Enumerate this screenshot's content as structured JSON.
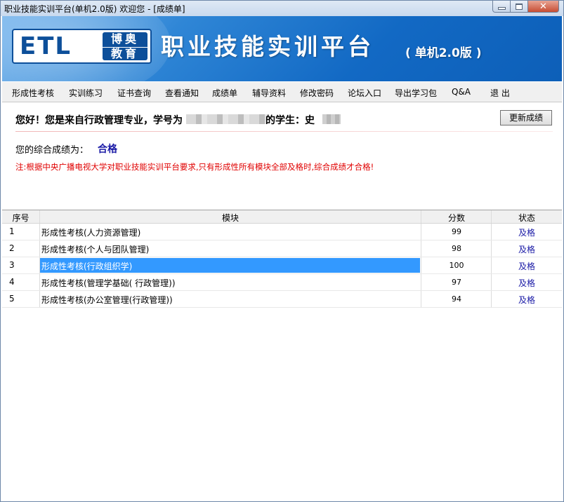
{
  "window": {
    "title": "职业技能实训平台(单机2.0版)  欢迎您 - [成绩单]",
    "controls": [
      "minimize-icon",
      "maximize-icon",
      "close-icon"
    ]
  },
  "banner": {
    "logo_text": "ETL",
    "logo_sub_line1": "博奥",
    "logo_sub_line2": "教育",
    "headline": "职业技能实训平台",
    "edition": "( 单机2.0版 )"
  },
  "menu": {
    "items": [
      "形成性考核",
      "实训练习",
      "证书查询",
      "查看通知",
      "成绩单",
      "辅导资料",
      "修改密码",
      "论坛入口",
      "导出学习包",
      "Q&A",
      "退 出"
    ]
  },
  "greeting": {
    "prefix": "您好！您是来自行政管理专业，学号为",
    "suffix": "的学生：史"
  },
  "update_button": "更新成绩",
  "score": {
    "label": "您的综合成绩为：",
    "value": "合格"
  },
  "notice": "注:根据中央广播电视大学对职业技能实训平台要求,只有形成性所有模块全部及格时,综合成绩才合格!",
  "table": {
    "headers": [
      "序号",
      "模块",
      "分数",
      "状态"
    ],
    "rows": [
      {
        "idx": "1",
        "module": "形成性考核(人力资源管理)",
        "score": "99",
        "status": "及格"
      },
      {
        "idx": "2",
        "module": "形成性考核(个人与团队管理)",
        "score": "98",
        "status": "及格"
      },
      {
        "idx": "3",
        "module": "形成性考核(行政组织学)",
        "score": "100",
        "status": "及格"
      },
      {
        "idx": "4",
        "module": "形成性考核(管理学基础( 行政管理))",
        "score": "97",
        "status": "及格"
      },
      {
        "idx": "5",
        "module": "形成性考核(办公室管理(行政管理))",
        "score": "94",
        "status": "及格"
      }
    ],
    "selected_row": 3
  },
  "colors": {
    "banner": "#1269c4",
    "selection": "#3399ff",
    "link": "#1a1aa6",
    "notice": "#e00000"
  }
}
